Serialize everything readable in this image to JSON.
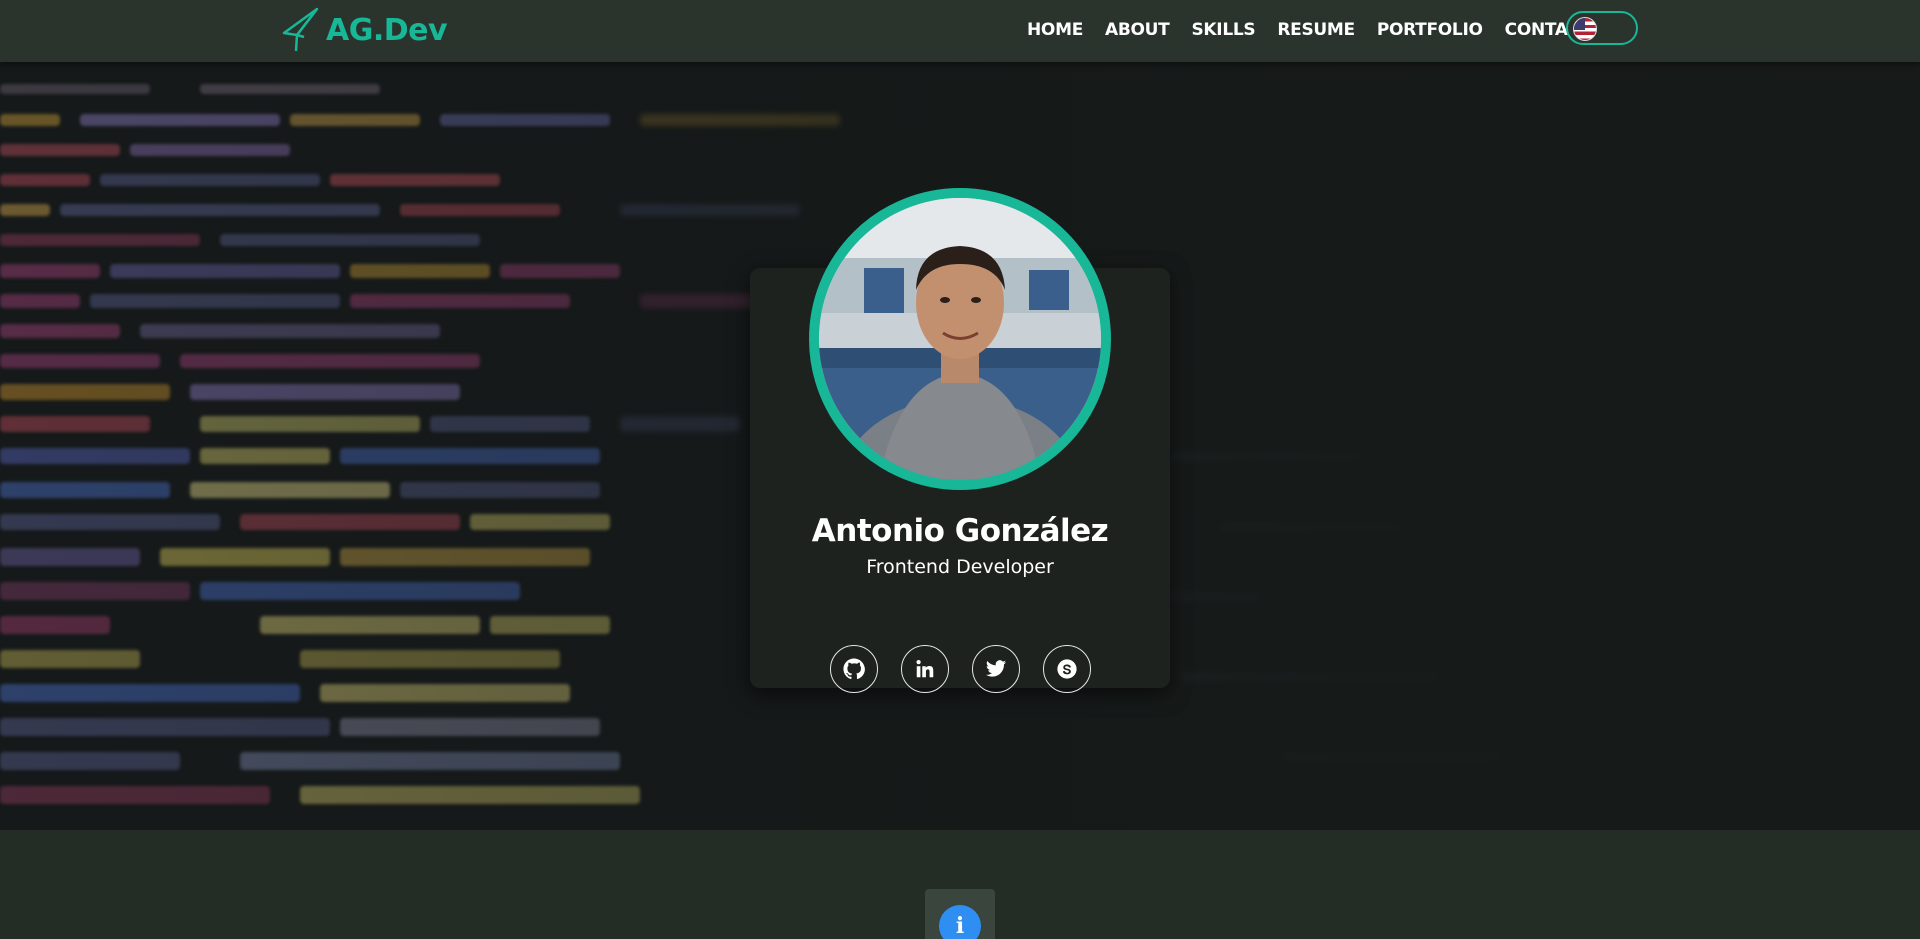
{
  "brand": {
    "name": "AG.Dev",
    "accent": "#17b797"
  },
  "nav": {
    "items": [
      {
        "label": "HOME"
      },
      {
        "label": "ABOUT"
      },
      {
        "label": "SKILLS"
      },
      {
        "label": "RESUME"
      },
      {
        "label": "PORTFOLIO"
      },
      {
        "label": "CONTACT"
      }
    ],
    "language_toggle": {
      "icon": "us-flag-icon"
    }
  },
  "profile": {
    "name": "Antonio González",
    "title": "Frontend Developer",
    "socials": [
      {
        "icon": "github-icon"
      },
      {
        "icon": "linkedin-icon"
      },
      {
        "icon": "twitter-icon"
      },
      {
        "icon": "skype-icon"
      }
    ]
  },
  "section_tab": {
    "icon": "info-icon",
    "glyph": "i",
    "color": "#2f8ef2"
  }
}
